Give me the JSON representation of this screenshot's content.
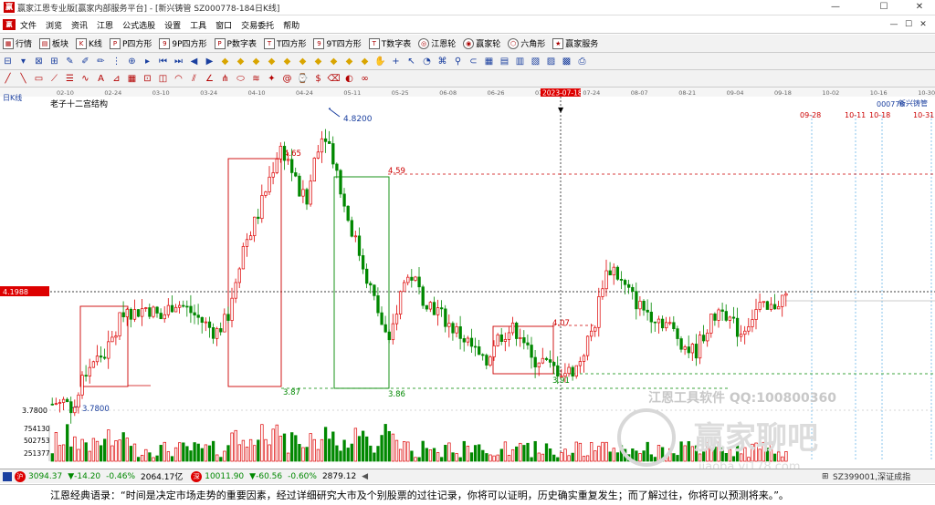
{
  "window": {
    "title": "赢家江恩专业版[赢家内部服务平台] - [新兴铸管  SZ000778-184日K线]",
    "controls": [
      "—",
      "☐",
      "✕"
    ]
  },
  "menu": {
    "items": [
      "文件",
      "浏览",
      "资讯",
      "江恩",
      "公式选股",
      "设置",
      "工具",
      "窗口",
      "交易委托",
      "帮助"
    ],
    "right_buttons": [
      "—",
      "☐",
      "✕"
    ]
  },
  "toolbar1": {
    "items": [
      {
        "label": "行情",
        "icon": "grid-icon"
      },
      {
        "label": "板块",
        "icon": "blocks-icon"
      },
      {
        "label": "K线",
        "icon": "kline-icon"
      },
      {
        "label": "P四方形",
        "icon": "p-square-icon"
      },
      {
        "label": "9P四方形",
        "icon": "9p-square-icon"
      },
      {
        "label": "P数字表",
        "icon": "p-table-icon"
      },
      {
        "label": "T四方形",
        "icon": "t-square-icon"
      },
      {
        "label": "9T四方形",
        "icon": "9t-square-icon"
      },
      {
        "label": "T数字表",
        "icon": "t-table-icon"
      },
      {
        "label": "江恩轮",
        "icon": "gann-wheel-icon"
      },
      {
        "label": "赢家轮",
        "icon": "winner-wheel-icon"
      },
      {
        "label": "六角形",
        "icon": "hexagon-icon"
      },
      {
        "label": "赢家服务",
        "icon": "service-icon"
      }
    ]
  },
  "chart_data": {
    "type": "candlestick",
    "title": "老子十二宫结构",
    "period_label": "日K线",
    "stock_code": "000778",
    "stock_name": "新兴铸管",
    "current_price_label": "4.1988",
    "cursor_date": "2023-07-18",
    "x_ticks": [
      "02-10",
      "02-24",
      "03-10",
      "03-24",
      "04-10",
      "04-24",
      "05-11",
      "05-25",
      "06-08",
      "06-26",
      "07-10",
      "07-24",
      "08-07",
      "08-21",
      "09-04",
      "09-18",
      "10-02",
      "10-16",
      "10-30"
    ],
    "future_dates": [
      "09-28",
      "10-11",
      "10-18",
      "10-31"
    ],
    "annotations": [
      "4.8200",
      "4.59",
      "4.07",
      "3.91",
      "3.87",
      "3.86",
      "3.7800",
      "3.7800",
      "4.65"
    ],
    "y_axis_labels": [
      "3.7800"
    ],
    "volume_axis_labels": [
      "754130",
      "502753",
      "251377"
    ],
    "watermarks": [
      "江恩工具软件  QQ:100800360",
      "赢家聊吧",
      "jiaoba.yj178.com"
    ]
  },
  "status": {
    "sh_value": "3094.37",
    "sh_change": "▼-14.20",
    "sh_pct": "-0.46%",
    "sh_amount": "2064.17亿",
    "sz_value": "10011.90",
    "sz_change": "▼-60.56",
    "sz_pct": "-0.60%",
    "sz_amount": "2879.12",
    "right_ticker": "SZ399001,深证成指"
  },
  "quote": "江恩经典语录：“时间是决定市场走势的重要因素，经过详细研究大市及个别股票的过往记录，你将可以证明，历史确实重复发生；而了解过往，你将可以预测将来。”。"
}
